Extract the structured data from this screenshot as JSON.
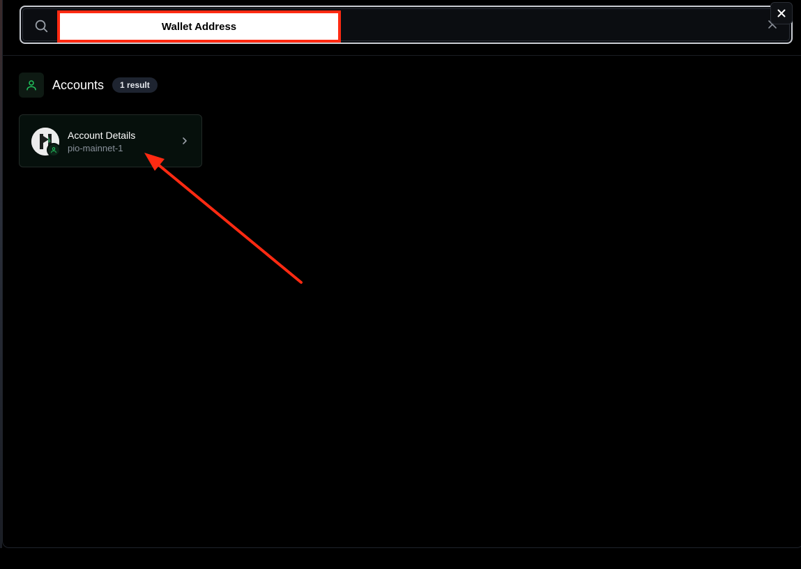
{
  "search": {
    "value": "Wallet Address",
    "icon": "search-icon",
    "clear_icon": "close-icon"
  },
  "dialog": {
    "close_label": "✕",
    "close_icon": "close-icon"
  },
  "section": {
    "icon": "user-icon",
    "title": "Accounts",
    "badge": "1 result"
  },
  "results": [
    {
      "title": "Account Details",
      "subtitle": "pio-mainnet-1",
      "avatar_icon": "provenance-logo-icon",
      "badge_icon": "user-icon",
      "chevron_icon": "chevron-right-icon"
    }
  ],
  "colors": {
    "background": "#000000",
    "accent_green": "#22c55e",
    "highlight_red": "#ff2a12",
    "badge_bg": "#1e2430"
  }
}
